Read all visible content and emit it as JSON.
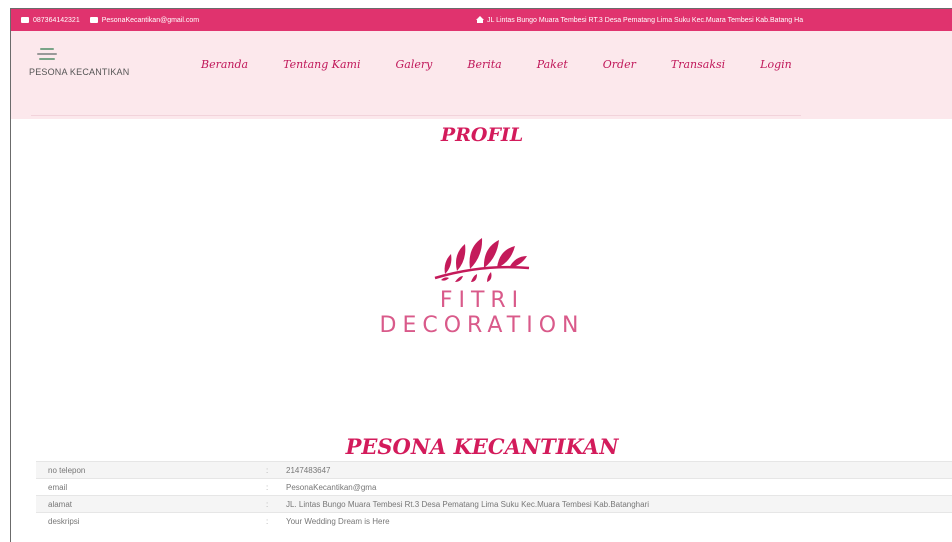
{
  "topbar": {
    "phone": "087364142321",
    "email": "PesonaKecantikan@gmail.com",
    "address": "JL Lintas Bungo Muara Tembesi RT.3 Desa Pematang Lima Suku Kec.Muara Tembesi Kab.Batang Ha"
  },
  "logo": {
    "name": "PESONA KECANTIKAN"
  },
  "nav": [
    "Beranda",
    "Tentang Kami",
    "Galery",
    "Berita",
    "Paket",
    "Order",
    "Transaksi",
    "Login"
  ],
  "profile_heading": "PROFIL",
  "brand": {
    "line1": "FITRI",
    "line2": "DECORATION"
  },
  "company_heading": "PESONA KECANTIKAN",
  "info_rows": [
    {
      "label": "no telepon",
      "sep": ":",
      "value": "2147483647"
    },
    {
      "label": "email",
      "sep": ":",
      "value": "PesonaKecantikan@gma"
    },
    {
      "label": "alamat",
      "sep": ":",
      "value": "JL. Lintas Bungo Muara Tembesi Rt.3 Desa Pematang Lima Suku Kec.Muara Tembesi Kab.Batanghari"
    },
    {
      "label": "deskripsi",
      "sep": ":",
      "value": "Your Wedding Dream is Here"
    }
  ],
  "colors": {
    "accent": "#e0336e",
    "nav_bg": "#fce8ec",
    "heading": "#d31b5b",
    "brand": "#d95a8a"
  }
}
